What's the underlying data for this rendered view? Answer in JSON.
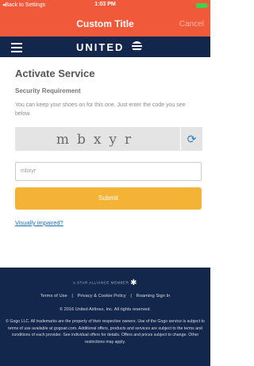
{
  "status_bar": {
    "back": "Back to Settings",
    "time": "1:03 PM"
  },
  "nav": {
    "title": "Custom Title",
    "cancel": "Cancel"
  },
  "header": {
    "logo": "UNITED"
  },
  "main": {
    "heading": "Activate Service",
    "subheading": "Security Requirement",
    "description": "You can keep your shoes on for this one. Just enter the code you see below.",
    "captcha_text": "mbxyr",
    "input_value": "mbxyr",
    "submit_label": "Submit",
    "visually_impaired": "Visually impaired?"
  },
  "footer": {
    "star_alliance": "A STAR ALLIANCE MEMBER",
    "links": [
      "Terms of Use",
      "Privacy & Cookie Policy",
      "Roaming Sign In"
    ],
    "separator": "|",
    "copyright": "© 2016 United Airlines, Inc. All rights reserved.",
    "gogo": "© Gogo LLC. All trademarks are the property of their respective owners. Use of the Gogo service is subject to terms of use available at gogoair.com. Additional offers, products and services are subject to the terms and conditions of each provider. See individual offers for details. Offers and prices subject to change. Other restrictions may apply."
  },
  "colors": {
    "accent": "#f05a3a",
    "brand_navy": "#13264b",
    "submit": "#f5b335",
    "link": "#1f6fb5"
  }
}
